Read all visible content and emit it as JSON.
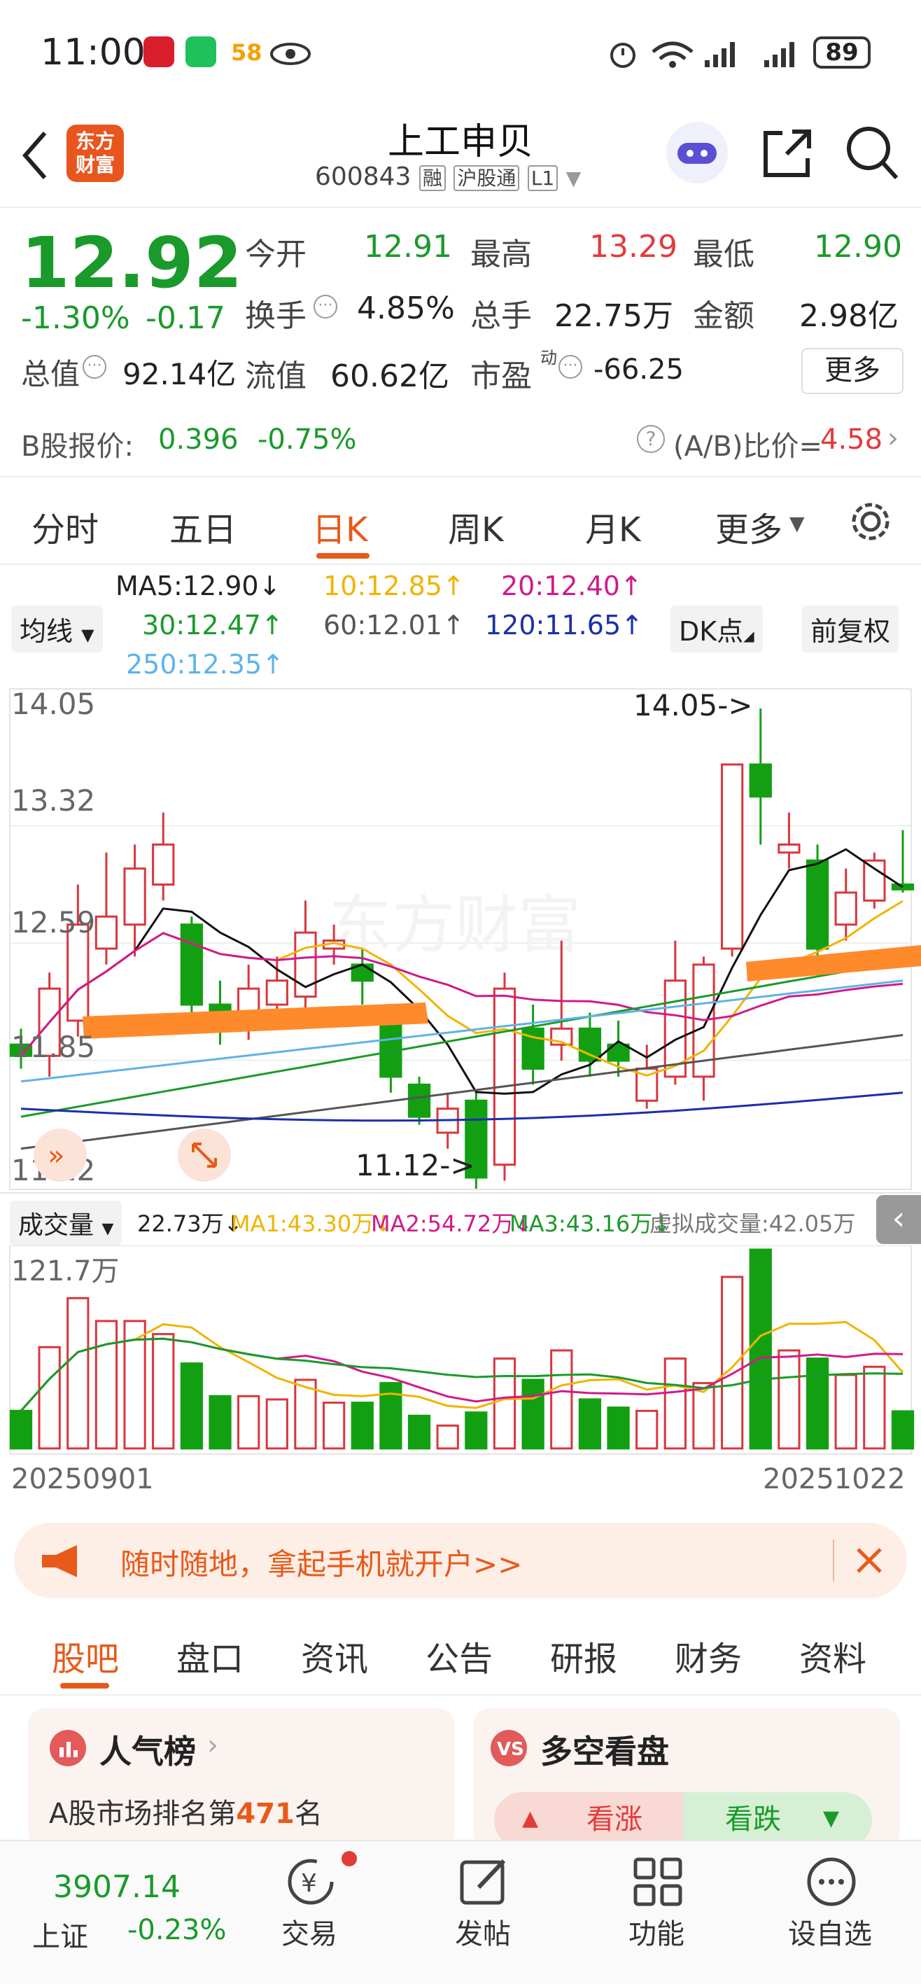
{
  "status": {
    "time": "11:00",
    "battery": "89",
    "app_badge": "58"
  },
  "nav": {
    "title": "上工申贝",
    "code": "600843",
    "tags": [
      "融",
      "沪股通",
      "L1"
    ],
    "logo_line1": "东方",
    "logo_line2": "财富"
  },
  "quote": {
    "price": "12.92",
    "change_pct": "-1.30%",
    "change": "-0.17",
    "open_label": "今开",
    "open": "12.91",
    "high_label": "最高",
    "high": "13.29",
    "low_label": "最低",
    "low": "12.90",
    "turnover_label": "换手",
    "turnover": "4.85%",
    "volume_label": "总手",
    "volume": "22.75万",
    "amount_label": "金额",
    "amount": "2.98亿",
    "mktcap_label": "总值",
    "mktcap": "92.14亿",
    "float_label": "流值",
    "float": "60.62亿",
    "pe_label": "市盈",
    "pe_sup": "动",
    "pe": "-66.25",
    "more": "更多"
  },
  "bshare": {
    "label": "B股报价:",
    "price": "0.396",
    "change": "-0.75%",
    "ratio_label": "(A/B)比价=",
    "ratio": "4.58"
  },
  "tabs": [
    "分时",
    "五日",
    "日K",
    "周K",
    "月K",
    "更多"
  ],
  "active_tab": "日K",
  "ma": {
    "selector": "均线",
    "ma5": "MA5:12.90↓",
    "ma10": "10:12.85↑",
    "ma20": "20:12.40↑",
    "ma30": "30:12.47↑",
    "ma60": "60:12.01↑",
    "ma120": "120:11.65↑",
    "ma250": "250:12.35↑",
    "dk": "DK点",
    "adjust": "前复权"
  },
  "kline_labels": {
    "y_ticks": [
      "14.05",
      "13.32",
      "12.59",
      "11.85",
      "11.12"
    ],
    "high_mark": "14.05->",
    "low_mark": "11.12->",
    "watermark": "东方财富"
  },
  "volume_panel": {
    "selector": "成交量",
    "vol": "22.73万↓",
    "ma1": "MA1:43.30万↓",
    "ma2": "MA2:54.72万↓",
    "ma3": "MA3:43.16万↓",
    "virtual": "虚拟成交量:42.05万",
    "ymax": "121.7万",
    "date_start": "20250901",
    "date_end": "20251022"
  },
  "ad": {
    "text": "随时随地，拿起手机就开户>>"
  },
  "bottom_tabs": [
    "股吧",
    "盘口",
    "资讯",
    "公告",
    "研报",
    "财务",
    "资料"
  ],
  "cards": {
    "popularity_title": "人气榜",
    "rank_text_prefix": "A股市场排名第",
    "rank": "471",
    "rank_suffix": "名",
    "bullbear_title": "多空看盘",
    "up": "看涨",
    "down": "看跌"
  },
  "bottom_nav": {
    "index_value": "3907.14",
    "index_name": "上证",
    "index_change": "-0.23%",
    "trade": "交易",
    "post": "发帖",
    "func": "功能",
    "watch": "设自选"
  },
  "chart_data": {
    "type": "candlestick",
    "ylim": [
      11.12,
      14.05
    ],
    "candles": [
      {
        "o": 11.95,
        "c": 11.88,
        "h": 12.05,
        "l": 11.8
      },
      {
        "o": 11.88,
        "c": 12.3,
        "h": 12.4,
        "l": 11.75
      },
      {
        "o": 12.1,
        "c": 12.7,
        "h": 12.95,
        "l": 12.0
      },
      {
        "o": 12.55,
        "c": 12.75,
        "h": 13.15,
        "l": 12.45
      },
      {
        "o": 12.7,
        "c": 13.05,
        "h": 13.2,
        "l": 12.5
      },
      {
        "o": 12.95,
        "c": 13.2,
        "h": 13.4,
        "l": 12.85
      },
      {
        "o": 12.7,
        "c": 12.2,
        "h": 12.75,
        "l": 12.1
      },
      {
        "o": 12.2,
        "c": 12.05,
        "h": 12.35,
        "l": 11.95
      },
      {
        "o": 12.15,
        "c": 12.3,
        "h": 12.45,
        "l": 11.98
      },
      {
        "o": 12.2,
        "c": 12.35,
        "h": 12.5,
        "l": 12.1
      },
      {
        "o": 12.25,
        "c": 12.65,
        "h": 12.85,
        "l": 12.05
      },
      {
        "o": 12.55,
        "c": 12.6,
        "h": 12.7,
        "l": 12.45
      },
      {
        "o": 12.45,
        "c": 12.35,
        "h": 12.55,
        "l": 12.2
      },
      {
        "o": 12.1,
        "c": 11.75,
        "h": 12.2,
        "l": 11.65
      },
      {
        "o": 11.7,
        "c": 11.5,
        "h": 11.75,
        "l": 11.45
      },
      {
        "o": 11.4,
        "c": 11.55,
        "h": 11.65,
        "l": 11.3
      },
      {
        "o": 11.6,
        "c": 11.12,
        "h": 11.65,
        "l": 11.05
      },
      {
        "o": 11.2,
        "c": 12.3,
        "h": 12.4,
        "l": 11.1
      },
      {
        "o": 12.05,
        "c": 11.8,
        "h": 12.2,
        "l": 11.7
      },
      {
        "o": 11.95,
        "c": 12.05,
        "h": 12.6,
        "l": 11.85
      },
      {
        "o": 12.05,
        "c": 11.85,
        "h": 12.15,
        "l": 11.75
      },
      {
        "o": 11.95,
        "c": 11.85,
        "h": 12.1,
        "l": 11.75
      },
      {
        "o": 11.6,
        "c": 11.8,
        "h": 11.95,
        "l": 11.55
      },
      {
        "o": 11.75,
        "c": 12.35,
        "h": 12.6,
        "l": 11.7
      },
      {
        "o": 11.75,
        "c": 12.45,
        "h": 12.5,
        "l": 11.6
      },
      {
        "o": 12.55,
        "c": 13.7,
        "h": 13.7,
        "l": 12.5
      },
      {
        "o": 13.7,
        "c": 13.5,
        "h": 14.05,
        "l": 13.2
      },
      {
        "o": 13.15,
        "c": 13.2,
        "h": 13.4,
        "l": 13.05
      },
      {
        "o": 13.1,
        "c": 12.55,
        "h": 13.2,
        "l": 12.5
      },
      {
        "o": 12.7,
        "c": 12.9,
        "h": 13.05,
        "l": 12.6
      },
      {
        "o": 12.85,
        "c": 13.1,
        "h": 13.15,
        "l": 12.8
      },
      {
        "o": 12.95,
        "c": 12.92,
        "h": 13.29,
        "l": 12.9
      }
    ],
    "volumes": [
      0.23,
      0.62,
      0.92,
      0.78,
      0.78,
      0.7,
      0.52,
      0.32,
      0.32,
      0.3,
      0.42,
      0.28,
      0.28,
      0.4,
      0.2,
      0.14,
      0.22,
      0.55,
      0.42,
      0.6,
      0.3,
      0.25,
      0.23,
      0.55,
      0.4,
      1.05,
      1.217,
      0.6,
      0.55,
      0.45,
      0.5,
      0.2273
    ]
  }
}
